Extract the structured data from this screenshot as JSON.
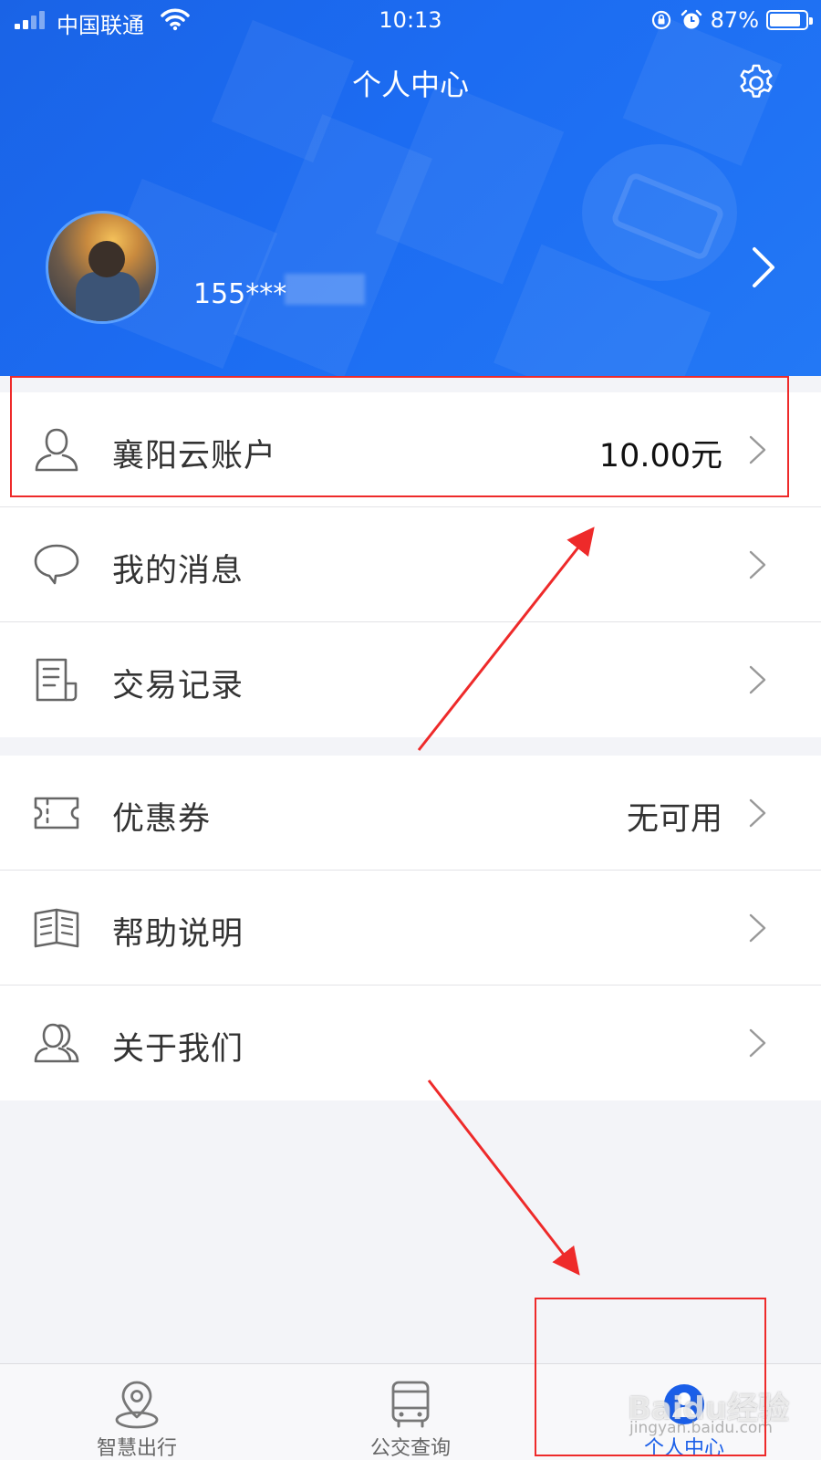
{
  "status_bar": {
    "carrier": "中国联通",
    "time": "10:13",
    "battery": "87%",
    "battery_level": 0.87
  },
  "header": {
    "title": "个人中心",
    "phone": "155***"
  },
  "menu": {
    "group1": [
      {
        "label": "襄阳云账户",
        "value": "10.00元",
        "icon": "user-icon"
      },
      {
        "label": "我的消息",
        "value": "",
        "icon": "message-icon"
      },
      {
        "label": "交易记录",
        "value": "",
        "icon": "receipt-icon"
      }
    ],
    "group2": [
      {
        "label": "优惠券",
        "value": "无可用",
        "icon": "coupon-icon"
      },
      {
        "label": "帮助说明",
        "value": "",
        "icon": "book-icon"
      },
      {
        "label": "关于我们",
        "value": "",
        "icon": "users-icon"
      }
    ]
  },
  "tabbar": [
    {
      "label": "智慧出行",
      "icon": "location-pin-icon",
      "active": false
    },
    {
      "label": "公交查询",
      "icon": "bus-icon",
      "active": false
    },
    {
      "label": "个人中心",
      "icon": "profile-icon",
      "active": true
    }
  ],
  "colors": {
    "header_blue": "#1c6cf2",
    "active_tab": "#1a5ee8",
    "annotation_red": "#ee2a2a"
  },
  "watermark": {
    "main": "Baidu经验",
    "sub": "jingyan.baidu.com"
  }
}
